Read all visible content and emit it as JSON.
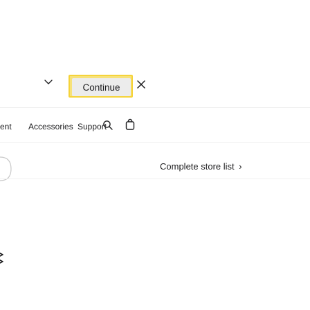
{
  "banner": {
    "continue_label": "Continue"
  },
  "nav": {
    "items": [
      "ent",
      "Accessories",
      "Support"
    ]
  },
  "store": {
    "link_label": "Complete store list",
    "link_chevron": "›"
  },
  "icons": {
    "chevron": "chevron-down-icon",
    "close": "close-icon",
    "search": "search-icon",
    "bag": "shopping-bag-icon"
  },
  "colors": {
    "focus_ring": "#f5d33a",
    "button_bg": "#ececec",
    "text": "#1d1d1f"
  }
}
